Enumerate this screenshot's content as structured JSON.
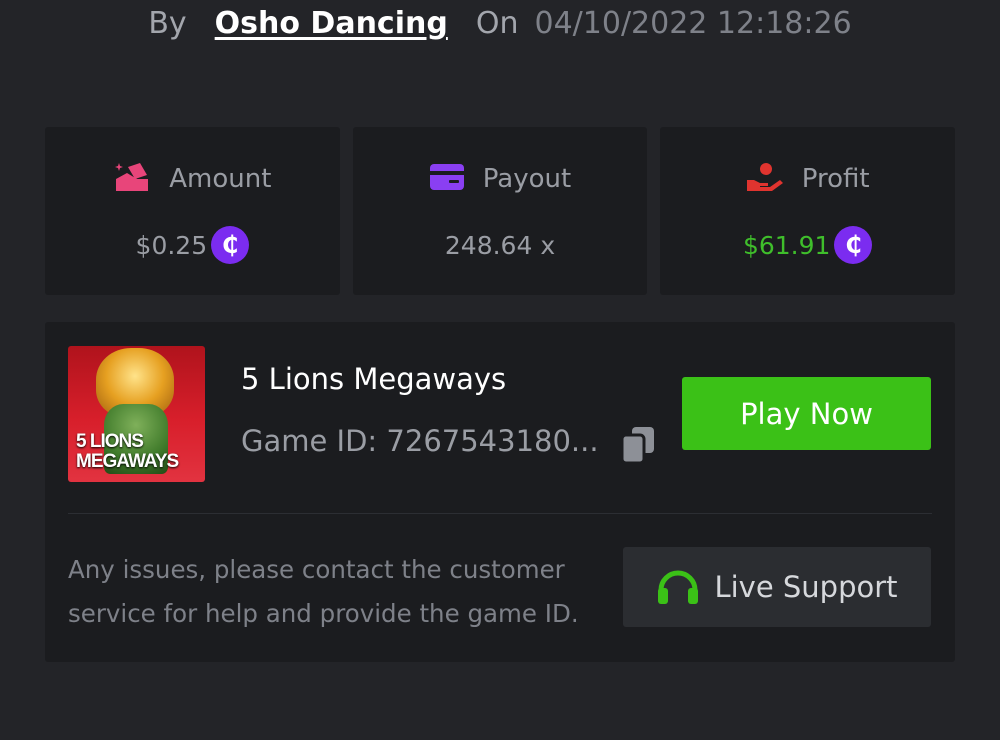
{
  "header": {
    "by_label": "By",
    "user_name": "Osho Dancing",
    "on_label": "On",
    "datetime": "04/10/2022 12:18:26"
  },
  "stats": {
    "amount": {
      "label": "Amount",
      "value": "$0.25",
      "icon": "bet-amount-icon",
      "currency_symbol": "₵"
    },
    "payout": {
      "label": "Payout",
      "value": "248.64 x",
      "icon": "card-icon"
    },
    "profit": {
      "label": "Profit",
      "value": "$61.91",
      "icon": "hand-profit-icon",
      "currency_symbol": "₵",
      "color": "#3fbe2b"
    }
  },
  "game": {
    "thumbnail_title": "5 LIONS MEGAWAYS",
    "name": "5 Lions Megaways",
    "id_text": "Game ID: 7267543180...",
    "play_label": "Play Now"
  },
  "support": {
    "message": "Any issues, please contact the customer service for help and provide the game ID.",
    "button_label": "Live Support"
  },
  "colors": {
    "background": "#232428",
    "card": "#1b1c1f",
    "accent_green": "#3bc117",
    "coin_purple": "#7b2cf0",
    "amount_icon": "#e8457a",
    "payout_icon": "#8a3ff2",
    "profit_icon": "#e0342f"
  }
}
